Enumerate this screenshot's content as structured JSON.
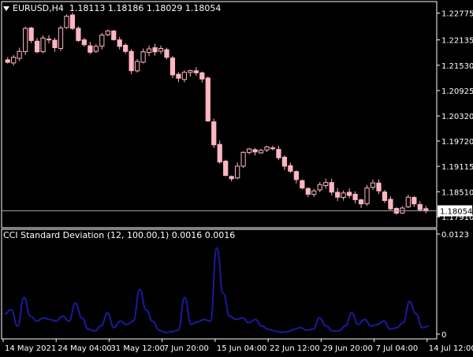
{
  "symbol_header": {
    "symbol": "EURUSD,H4",
    "ohlc": "1.18113 1.18186 1.18029 1.18054"
  },
  "indicator_header": {
    "name": "CCI Standard Deviation (12, 100.00,1) 0.0016 0.0016"
  },
  "current_price_label": "1.18054",
  "colors": {
    "background": "#000000",
    "frame": "#ffffff",
    "candle": "#ffb6c1",
    "indicator_line": "#1a1aa0",
    "current_price_line": "#a0a0a0",
    "price_tag_bg": "#ffffff",
    "price_tag_text": "#000000"
  },
  "chart_data": [
    {
      "type": "candlestick",
      "title": "EURUSD,H4",
      "ylim": [
        1.1765,
        1.2305
      ],
      "y_ticks": [
        "1.22775",
        "1.22135",
        "1.21530",
        "1.20925",
        "1.20320",
        "1.19720",
        "1.19115",
        "1.18510",
        "1.17910"
      ],
      "close_path": [
        1.216,
        1.2172,
        1.2186,
        1.2241,
        1.2212,
        1.2185,
        1.2218,
        1.2215,
        1.2195,
        1.2242,
        1.227,
        1.2241,
        1.2212,
        1.2202,
        1.2184,
        1.2198,
        1.2225,
        1.2235,
        1.2214,
        1.2198,
        1.2186,
        1.214,
        1.2162,
        1.2185,
        1.2192,
        1.2185,
        1.2193,
        1.2172,
        1.213,
        1.2122,
        1.2136,
        1.214,
        1.2135,
        1.212,
        1.202,
        1.1963,
        1.1922,
        1.189,
        1.1882,
        1.1912,
        1.1945,
        1.1953,
        1.1946,
        1.195,
        1.1958,
        1.1955,
        1.1932,
        1.1912,
        1.19,
        1.188,
        1.186,
        1.1845,
        1.1853,
        1.1868,
        1.1873,
        1.185,
        1.1838,
        1.1848,
        1.1842,
        1.1832,
        1.1822,
        1.186,
        1.1872,
        1.1853,
        1.183,
        1.181,
        1.18,
        1.1812,
        1.1838,
        1.1822,
        1.1808,
        1.1805
      ]
    },
    {
      "type": "line",
      "title": "CCI Standard Deviation (12, 100.00,1)",
      "ylim": [
        0,
        0.0123
      ],
      "y_ticks": [
        "0.0123",
        "0"
      ],
      "x_ticks": [
        "14 May 2021",
        "24 May 04:00",
        "31 May 12:00",
        "7 Jun 20:00",
        "15 Jun 04:00",
        "22 Jun 12:00",
        "29 Jun 20:00",
        "7 Jul 04:00",
        "14 Jul 12:00"
      ],
      "series": [
        {
          "values": [
            0.0025,
            0.003,
            0.001,
            0.0045,
            0.0022,
            0.0016,
            0.002,
            0.0018,
            0.0016,
            0.0022,
            0.0016,
            0.0038,
            0.002,
            0.0006,
            0.0004,
            0.001,
            0.0026,
            0.0008,
            0.0016,
            0.0012,
            0.0016,
            0.0055,
            0.003,
            0.0016,
            0.0005,
            0.0002,
            0.0003,
            0.0005,
            0.0045,
            0.0012,
            0.0015,
            0.0018,
            0.0016,
            0.0106,
            0.005,
            0.0022,
            0.0018,
            0.002,
            0.0014,
            0.0018,
            0.001,
            0.0006,
            0.0004,
            0.0002,
            0.0003,
            0.0006,
            0.0008,
            0.0005,
            0.0006,
            0.002,
            0.001,
            0.0004,
            0.0004,
            0.001,
            0.0026,
            0.0012,
            0.0018,
            0.001,
            0.0012,
            0.0016,
            0.0006,
            0.0008,
            0.0014,
            0.004,
            0.0025,
            0.0008,
            0.001
          ]
        }
      ]
    }
  ]
}
